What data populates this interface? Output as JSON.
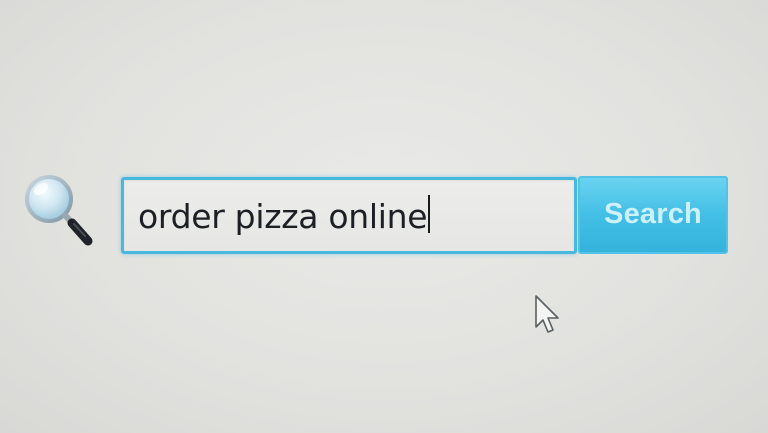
{
  "search": {
    "value": "order pizza online",
    "button_label": "Search"
  },
  "icons": {
    "search": "magnifying-glass-icon",
    "cursor": "mouse-pointer-icon"
  },
  "colors": {
    "background": "#e4e4e1",
    "input_border": "#48b8dc",
    "button_fill": "#43bfe5",
    "button_text": "#cdf0fa",
    "text": "#1c1f24"
  }
}
